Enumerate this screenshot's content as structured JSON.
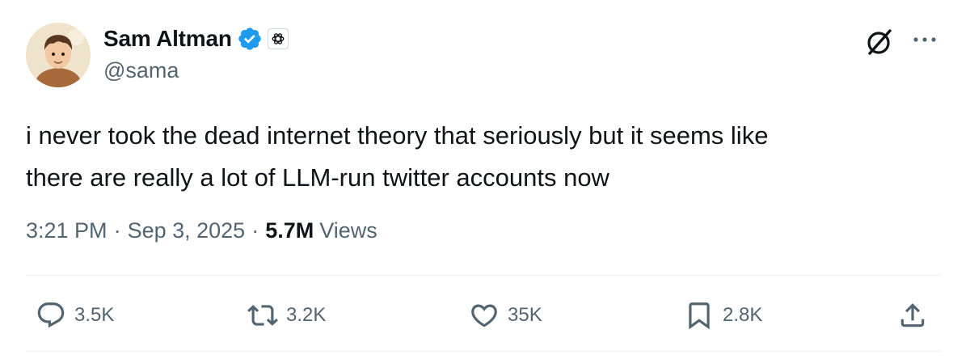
{
  "author": {
    "name": "Sam Altman",
    "handle": "@sama",
    "verified_color": "#1d9bf0"
  },
  "tweet": {
    "text_lines": [
      "i never took the dead internet theory that seriously but it seems like",
      "there are really a lot of LLM-run twitter accounts now"
    ],
    "time": "3:21 PM",
    "separator": "·",
    "date": "Sep 3, 2025",
    "views_count": "5.7M",
    "views_label": "Views"
  },
  "actions": {
    "replies": "3.5K",
    "retweets": "3.2K",
    "likes": "35K",
    "bookmarks": "2.8K"
  },
  "icons": {
    "header_right": [
      "grok-icon",
      "more-icon"
    ],
    "actions": [
      "reply-icon",
      "retweet-icon",
      "like-icon",
      "bookmark-icon",
      "share-icon"
    ]
  }
}
